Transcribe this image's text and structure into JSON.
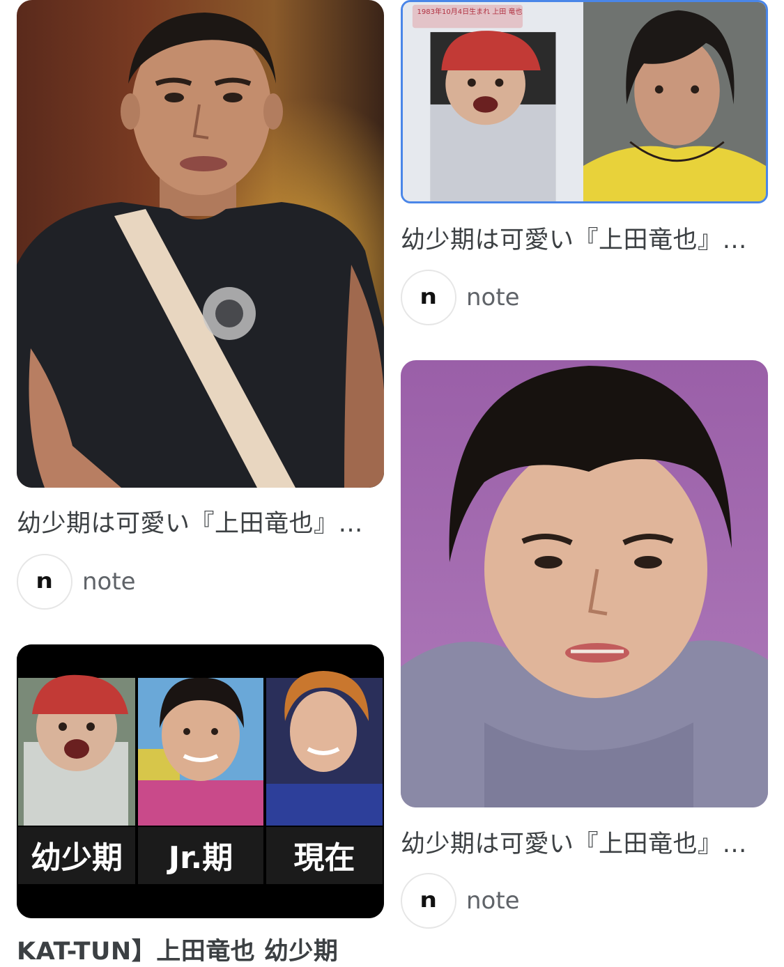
{
  "results": [
    {
      "caption": "幼少期は可愛い『上田竜也』…",
      "source": "note",
      "favicon_letter": "n"
    },
    {
      "caption": "幼少期は可愛い『上田竜也』…",
      "source": "note",
      "favicon_letter": "n"
    },
    {
      "caption": "幼少期は可愛い『上田竜也』…",
      "source": "note",
      "favicon_letter": "n"
    },
    {
      "caption": "KAT-TUN】上田竜也 幼少期",
      "source": "",
      "favicon_letter": ""
    }
  ],
  "collage_labels": [
    "幼少期",
    "Jr.期",
    "現在"
  ],
  "photo_stamp": "1983年10月4日生まれ 上田 竜也",
  "colors": {
    "caption_text": "#3c4043",
    "source_text": "#5f6368",
    "favicon_border": "#e6e6e6",
    "selected_border": "#4a86e8"
  }
}
